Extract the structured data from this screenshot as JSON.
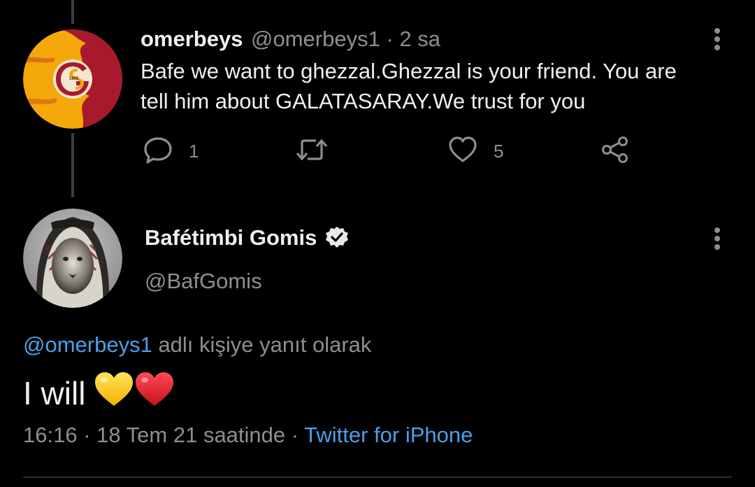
{
  "reply_tweet": {
    "author_name": "omerbeys",
    "author_handle": "@omerbeys1",
    "separator": "·",
    "time_ago": "2 sa",
    "text_line1": "Bafe we want to ghezzal.Ghezzal is your friend. You are",
    "text_line2": "tell him about GALATASARAY.We trust for you",
    "reply_count": "1",
    "like_count": "5",
    "avatar_badge_text": "1905",
    "colors": {
      "avatar_red": "#a8192e",
      "avatar_yellow": "#f5a80a"
    }
  },
  "main_tweet": {
    "author_name": "Bafétimbi Gomis",
    "author_handle": "@BafGomis",
    "reply_context_mention": "@omerbeys1",
    "reply_context_text": " adlı kişiye yanıt olarak",
    "text": "I will",
    "emojis": [
      "yellow-heart",
      "red-heart"
    ],
    "time": "16:16",
    "date": "18 Tem 21 saatinde",
    "sep": " · ",
    "source": "Twitter for iPhone"
  },
  "colors": {
    "background": "#000000",
    "link": "#4a9fe8",
    "muted": "#8b8f94"
  }
}
